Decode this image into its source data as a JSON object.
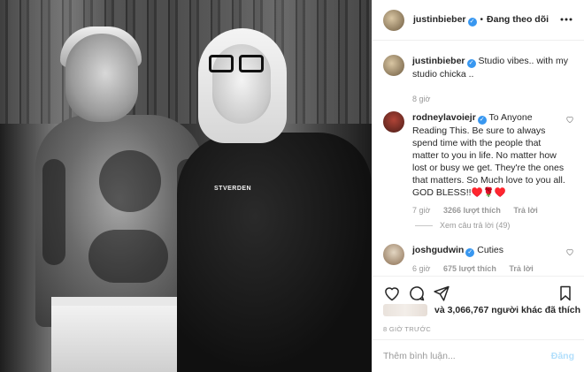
{
  "header": {
    "username": "justinbieber",
    "separator": "•",
    "follow_status": "Đang theo dõi",
    "more_icon": "more-horizontal-icon"
  },
  "photo": {
    "sweater_text": "STVERDEN"
  },
  "caption": {
    "username": "justinbieber",
    "text": "Studio vibes.. with my studio chicka ..",
    "time": "8 giờ"
  },
  "comments": [
    {
      "username": "rodneylavoiejr",
      "text": "To Anyone Reading This. Be sure to always spend time with the people that matter to you in life. No matter how lost or busy we get. They're the ones that matters. So Much love to you all. GOD BLESS!!♥️🌹♥️",
      "time": "7 giờ",
      "likes": "3266 lượt thích",
      "reply": "Trả lời",
      "view_replies": "Xem câu trả lời (49)"
    },
    {
      "username": "joshgudwin",
      "text": "Cuties",
      "time": "6 giờ",
      "likes": "675 lượt thích",
      "reply": "Trả lời"
    }
  ],
  "likes_summary": "và 3,066,767 người khác đã thích",
  "post_time": "8 GIỜ TRƯỚC",
  "comment_box": {
    "placeholder": "Thêm bình luận...",
    "post_label": "Đăng"
  },
  "colors": {
    "verified": "#3897f0",
    "muted": "#999999",
    "post_disabled": "#b2dffc"
  }
}
